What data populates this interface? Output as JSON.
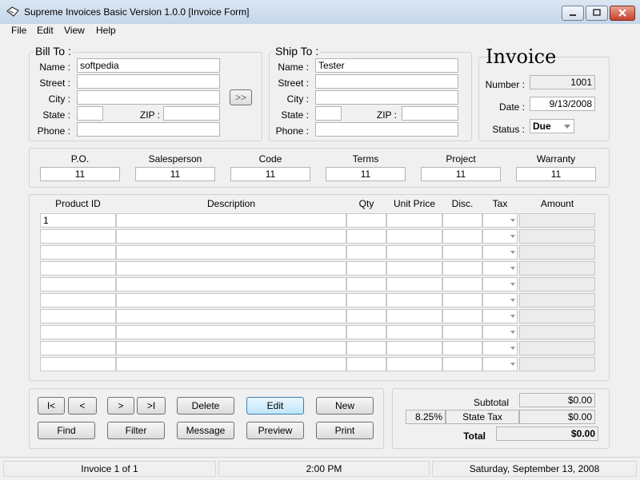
{
  "window": {
    "title": "Supreme Invoices Basic Version 1.0.0  [Invoice Form]"
  },
  "menu": [
    "File",
    "Edit",
    "View",
    "Help"
  ],
  "bill_to": {
    "heading": "Bill To :",
    "labels": {
      "name": "Name :",
      "street": "Street :",
      "city": "City :",
      "state": "State :",
      "zip": "ZIP :",
      "phone": "Phone :"
    },
    "values": {
      "name": "softpedia",
      "street": "",
      "city": "",
      "state": "",
      "zip": "",
      "phone": ""
    },
    "copy_button": ">>"
  },
  "ship_to": {
    "heading": "Ship To :",
    "labels": {
      "name": "Name :",
      "street": "Street :",
      "city": "City :",
      "state": "State :",
      "zip": "ZIP :",
      "phone": "Phone :"
    },
    "values": {
      "name": "Tester",
      "street": "",
      "city": "",
      "state": "",
      "zip": "",
      "phone": ""
    }
  },
  "invoice": {
    "heading": "Invoice",
    "number_label": "Number :",
    "number": "1001",
    "date_label": "Date :",
    "date": "9/13/2008",
    "status_label": "Status :",
    "status": "Due"
  },
  "meta": {
    "headers": [
      "P.O.",
      "Salesperson",
      "Code",
      "Terms",
      "Project",
      "Warranty"
    ],
    "values": [
      "11",
      "11",
      "11",
      "11",
      "11",
      "11"
    ]
  },
  "items": {
    "headers": {
      "product_id": "Product ID",
      "description": "Description",
      "qty": "Qty",
      "unit_price": "Unit Price",
      "disc": "Disc.",
      "tax": "Tax",
      "amount": "Amount"
    },
    "rows": [
      {
        "product_id": "1",
        "description": "",
        "qty": "",
        "unit_price": "",
        "disc": "",
        "amount": ""
      },
      {
        "product_id": "",
        "description": "",
        "qty": "",
        "unit_price": "",
        "disc": "",
        "amount": ""
      },
      {
        "product_id": "",
        "description": "",
        "qty": "",
        "unit_price": "",
        "disc": "",
        "amount": ""
      },
      {
        "product_id": "",
        "description": "",
        "qty": "",
        "unit_price": "",
        "disc": "",
        "amount": ""
      },
      {
        "product_id": "",
        "description": "",
        "qty": "",
        "unit_price": "",
        "disc": "",
        "amount": ""
      },
      {
        "product_id": "",
        "description": "",
        "qty": "",
        "unit_price": "",
        "disc": "",
        "amount": ""
      },
      {
        "product_id": "",
        "description": "",
        "qty": "",
        "unit_price": "",
        "disc": "",
        "amount": ""
      },
      {
        "product_id": "",
        "description": "",
        "qty": "",
        "unit_price": "",
        "disc": "",
        "amount": ""
      },
      {
        "product_id": "",
        "description": "",
        "qty": "",
        "unit_price": "",
        "disc": "",
        "amount": ""
      },
      {
        "product_id": "",
        "description": "",
        "qty": "",
        "unit_price": "",
        "disc": "",
        "amount": ""
      }
    ]
  },
  "nav": {
    "first": "I<",
    "prev": "<",
    "next": ">",
    "last": ">I"
  },
  "actions": {
    "delete": "Delete",
    "edit": "Edit",
    "new": "New",
    "find": "Find",
    "filter": "Filter",
    "message": "Message",
    "preview": "Preview",
    "print": "Print"
  },
  "totals": {
    "subtotal_label": "Subtotal",
    "subtotal": "$0.00",
    "tax_rate": "8.25%",
    "state_tax_label": "State Tax",
    "state_tax": "$0.00",
    "total_label": "Total",
    "total": "$0.00"
  },
  "status": {
    "record": "Invoice 1 of 1",
    "time": "2:00 PM",
    "date": "Saturday, September 13, 2008"
  },
  "colors": {
    "focus_border": "#3c7fb1",
    "close_button": "#c5432b"
  }
}
